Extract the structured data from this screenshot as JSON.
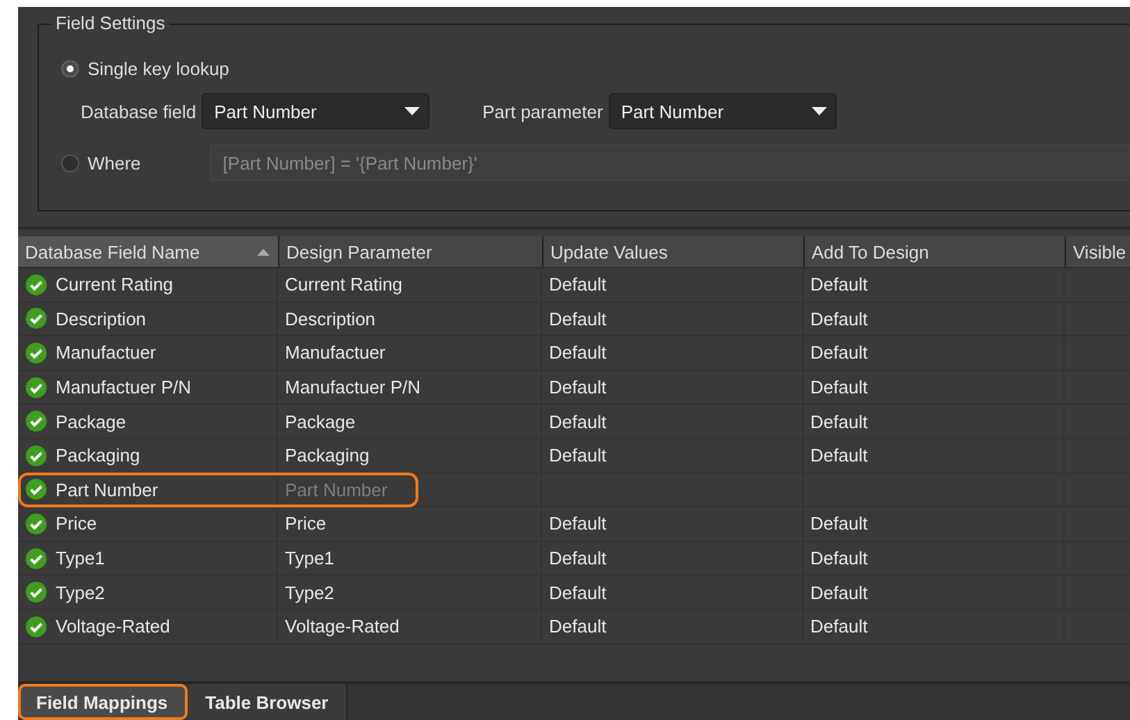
{
  "field_settings": {
    "title": "Field Settings",
    "options": [
      {
        "label": "Single key lookup",
        "selected": true
      },
      {
        "label": "Where",
        "selected": false
      }
    ],
    "database_field": {
      "label": "Database field",
      "value": "Part Number"
    },
    "part_parameter": {
      "label": "Part parameter",
      "value": "Part Number"
    },
    "where_field": {
      "value": "[Part Number] = '{Part Number}'",
      "disabled": true
    }
  },
  "table": {
    "columns": [
      {
        "label": "Database Field Name",
        "sorted": true
      },
      {
        "label": "Design Parameter",
        "sorted": false
      },
      {
        "label": "Update Values",
        "sorted": false
      },
      {
        "label": "Add To Design",
        "sorted": false
      },
      {
        "label": "Visible",
        "sorted": false
      }
    ],
    "rows": [
      {
        "field": "Current Rating",
        "parameter": "Current Rating",
        "update_values": "Default",
        "add_to_design": "Default",
        "dimmed": false,
        "highlighted": false
      },
      {
        "field": "Description",
        "parameter": "Description",
        "update_values": "Default",
        "add_to_design": "Default",
        "dimmed": false,
        "highlighted": false
      },
      {
        "field": "Manufactuer",
        "parameter": "Manufactuer",
        "update_values": "Default",
        "add_to_design": "Default",
        "dimmed": false,
        "highlighted": false
      },
      {
        "field": "Manufactuer P/N",
        "parameter": "Manufactuer P/N",
        "update_values": "Default",
        "add_to_design": "Default",
        "dimmed": false,
        "highlighted": false
      },
      {
        "field": "Package",
        "parameter": "Package",
        "update_values": "Default",
        "add_to_design": "Default",
        "dimmed": false,
        "highlighted": false
      },
      {
        "field": "Packaging",
        "parameter": "Packaging",
        "update_values": "Default",
        "add_to_design": "Default",
        "dimmed": false,
        "highlighted": false
      },
      {
        "field": "Part Number",
        "parameter": "Part Number",
        "dimmed": true,
        "highlighted": true
      },
      {
        "field": "Price",
        "parameter": "Price",
        "update_values": "Default",
        "add_to_design": "Default",
        "dimmed": false,
        "highlighted": false
      },
      {
        "field": "Type1",
        "parameter": "Type1",
        "update_values": "Default",
        "add_to_design": "Default",
        "dimmed": false,
        "highlighted": false
      },
      {
        "field": "Type2",
        "parameter": "Type2",
        "update_values": "Default",
        "add_to_design": "Default",
        "dimmed": false,
        "highlighted": false
      },
      {
        "field": "Voltage-Rated",
        "parameter": "Voltage-Rated",
        "update_values": "Default",
        "add_to_design": "Default",
        "dimmed": false,
        "highlighted": false
      }
    ]
  },
  "tabs": [
    {
      "label": "Field Mappings",
      "selected": true,
      "highlighted": true
    },
    {
      "label": "Table Browser",
      "selected": false,
      "highlighted": false
    }
  ]
}
